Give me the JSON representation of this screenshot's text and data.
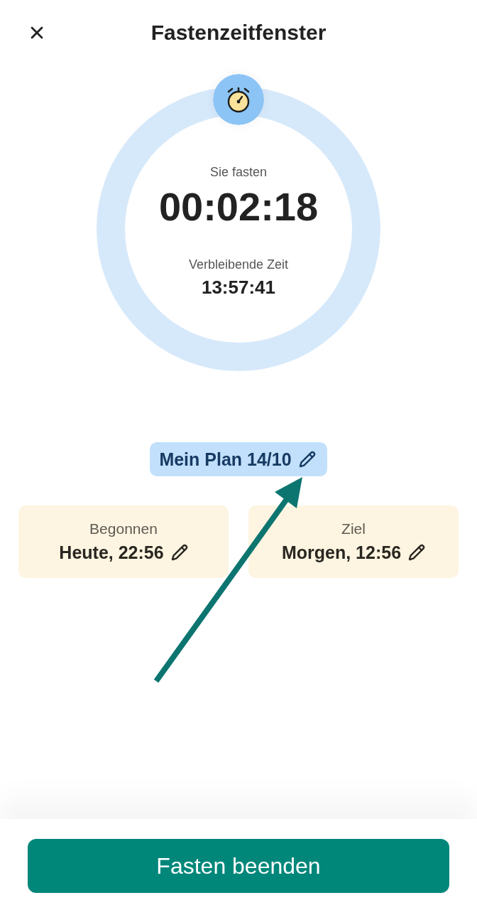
{
  "header": {
    "title": "Fastenzeitfenster"
  },
  "timer": {
    "status_label": "Sie fasten",
    "elapsed": "00:02:18",
    "remaining_label": "Verbleibende Zeit",
    "remaining": "13:57:41"
  },
  "plan": {
    "label": "Mein Plan 14/10"
  },
  "times": [
    {
      "label": "Begonnen",
      "value": "Heute, 22:56"
    },
    {
      "label": "Ziel",
      "value": "Morgen, 12:56"
    }
  ],
  "action": {
    "label": "Fasten beenden"
  }
}
